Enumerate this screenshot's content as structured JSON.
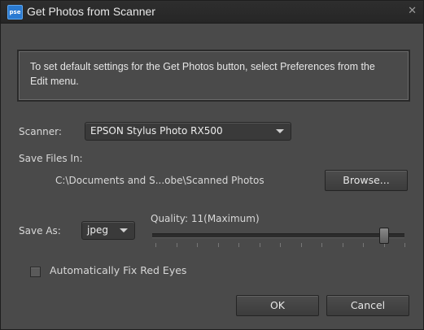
{
  "window": {
    "title": "Get Photos from Scanner",
    "app_icon_text": "pse"
  },
  "info": {
    "text": "To set default settings for the Get Photos button, select Preferences from the Edit menu."
  },
  "scanner": {
    "label": "Scanner:",
    "selected": "EPSON Stylus Photo RX500"
  },
  "save_files": {
    "label": "Save Files In:",
    "path": "C:\\Documents and S...obe\\Scanned Photos",
    "browse_label": "Browse..."
  },
  "save_as": {
    "label": "Save As:",
    "selected": "jpeg"
  },
  "quality": {
    "label": "Quality: 11(Maximum)",
    "value": 11,
    "max": 12
  },
  "red_eye": {
    "label": "Automatically Fix Red Eyes",
    "checked": false
  },
  "buttons": {
    "ok": "OK",
    "cancel": "Cancel"
  },
  "icons": {
    "app": "photoshop-elements-icon",
    "close": "close-icon",
    "dropdown": "chevron-down-icon"
  }
}
